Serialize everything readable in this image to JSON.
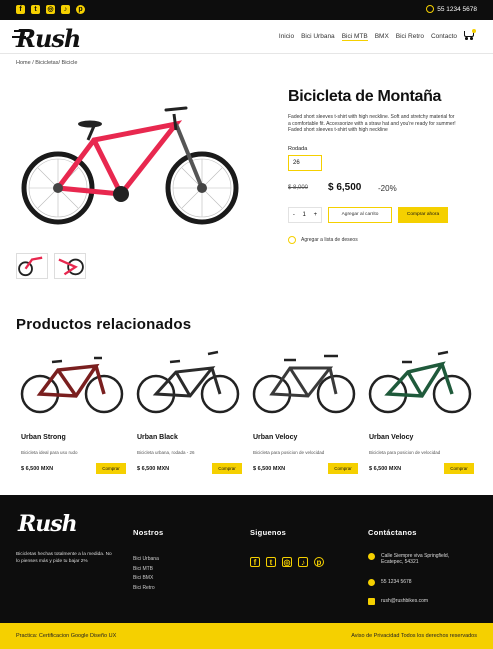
{
  "topbar": {
    "social_icons": [
      "facebook-icon",
      "twitter-icon",
      "instagram-icon",
      "tiktok-icon",
      "pinterest-icon"
    ],
    "phone": "55 1234 5678"
  },
  "nav": {
    "logo": "Rush",
    "items": [
      "Inicio",
      "Bici Urbana",
      "Bici MTB",
      "BMX",
      "Bici Retro",
      "Contacto"
    ],
    "active_item": "Bici MTB"
  },
  "breadcrumb": "Home / Bicicletas/ Bicicle",
  "product": {
    "title": "Bicicleta de Montaña",
    "description": "Faded short sleeves t-shirt with high neckline. Soft and stretchy material for a comfortable fit. Accessorize with a straw hat and you're ready for summer! Faded short sleeves t-shirt with high neckline",
    "size_label": "Rodada",
    "size_value": "26",
    "price_old": "$ 8,000",
    "price_new": "$ 6,500",
    "discount": "-20%",
    "qty_minus": "-",
    "qty_value": "1",
    "qty_plus": "+",
    "add_to_cart": "Agregar al carrito",
    "buy_now": "Comprar ahora",
    "wishlist": "Agregar a lista de deseos"
  },
  "related": {
    "title": "Productos relacionados",
    "items": [
      {
        "name": "Urban Strong",
        "desc": "Bicicleta ideal para uso rudo",
        "price": "$ 6,500 MXN",
        "button": "Comprar",
        "color": "#7a1f1f"
      },
      {
        "name": "Urban Black",
        "desc": "Bicicleta urbana, rodada - 26",
        "price": "$ 6,500 MXN",
        "button": "Comprar",
        "color": "#2b2b2b"
      },
      {
        "name": "Urban Velocy",
        "desc": "Bicicleta para posicion de velocidad",
        "price": "$ 6,500 MXN",
        "button": "Comprar",
        "color": "#3a3a3a"
      },
      {
        "name": "Urban Velocy",
        "desc": "Bicicleta para posicion de velocidad",
        "price": "$ 6,500 MXN",
        "button": "Comprar",
        "color": "#1f5a3b"
      }
    ]
  },
  "footer": {
    "logo": "Rush",
    "blurb": "Bicicletas hechas totalmente a la medida. No lo pienses más y pide tu bajar 2%",
    "col_nosotros": "Nostros",
    "links": [
      "Bici Urbana",
      "Bici MTB",
      "Bici BMX",
      "Bici Retro"
    ],
    "col_siguenos": "Siguenos",
    "col_contacto": "Contáctanos",
    "address": "Calle Siempre viva Springfield, Ecatepec, 54321",
    "phone": "55 1234 5678",
    "email": "rush@rushbikes.com"
  },
  "bottombar": {
    "left": "Practica: Certificacion Google Diseño UX",
    "right": "Aviso de Privacidad   Todos los derechos reservados"
  },
  "colors": {
    "accent": "#f5d000",
    "dark": "#0d0d0d",
    "hero_bike": "#e8284f"
  }
}
